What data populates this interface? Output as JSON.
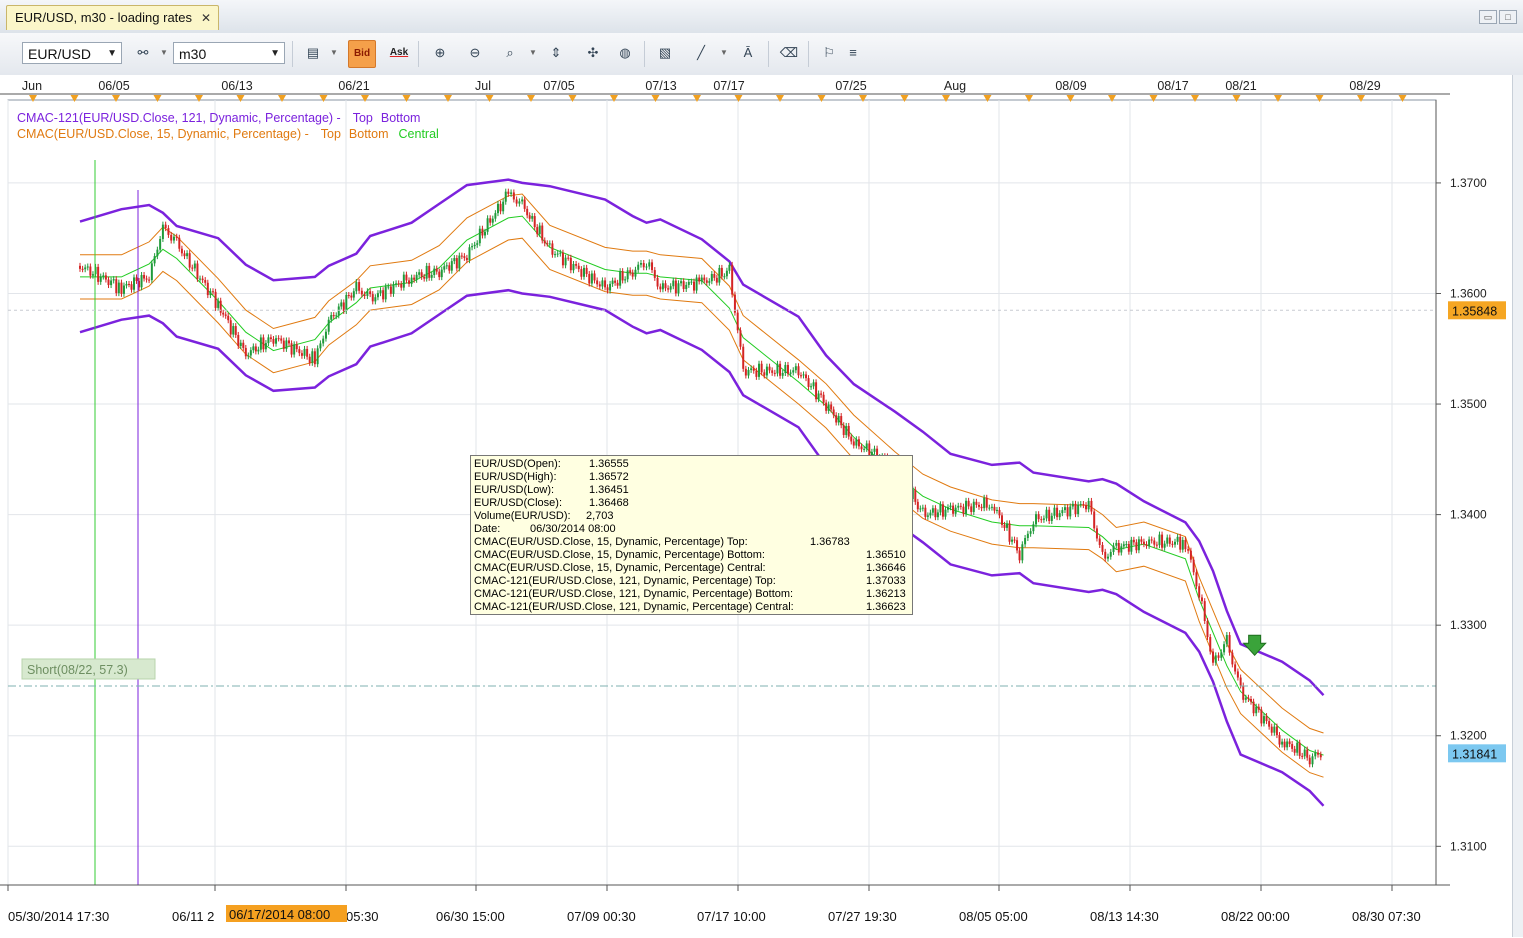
{
  "window": {
    "tab_title": "EUR/USD, m30 - loading rates",
    "close_glyph": "✕"
  },
  "toolbar": {
    "instrument": "EUR/USD",
    "timeframe": "m30",
    "bid_label": "Bid",
    "ask_label": "Ask"
  },
  "legend": {
    "line1_prefix": "CMAC-121(EUR/USD.Close, 121, Dynamic, Percentage) -",
    "line1_top": "Top",
    "line1_bottom": "Bottom",
    "line2_prefix": "CMAC(EUR/USD.Close, 15, Dynamic, Percentage) -",
    "line2_top": "Top",
    "line2_bottom": "Bottom",
    "line2_central": "Central"
  },
  "top_axis_labels": [
    "Jun",
    "06/05",
    "06/13",
    "06/21",
    "Jul",
    "07/05",
    "07/13",
    "07/17",
    "07/25",
    "Aug",
    "08/09",
    "08/17",
    "08/21",
    "08/29"
  ],
  "bottom_axis_labels": [
    "05/30/2014 17:30",
    "06/11 2",
    "05:30",
    "06/30 15:00",
    "07/09 00:30",
    "07/17 10:00",
    "07/27 19:30",
    "08/05 05:00",
    "08/13 14:30",
    "08/22 00:00",
    "08/30 07:30"
  ],
  "bottom_cursor_label": "06/17/2014 08:00",
  "price_labels": [
    "1.3700",
    "1.3600",
    "1.3500",
    "1.3400",
    "1.3300",
    "1.3200",
    "1.3100"
  ],
  "marker_price_1": "1.35848",
  "marker_price_2": "1.31841",
  "short_label": "Short(08/22, 57.3)",
  "tooltip": [
    {
      "label": "EUR/USD(Open):",
      "value": "1.36555"
    },
    {
      "label": "EUR/USD(High):",
      "value": "1.36572"
    },
    {
      "label": "EUR/USD(Low):",
      "value": "1.36451"
    },
    {
      "label": "EUR/USD(Close):",
      "value": "1.36468"
    },
    {
      "label": "Volume(EUR/USD):",
      "value": "2,703"
    },
    {
      "label": "Date:",
      "value": "06/30/2014 08:00"
    },
    {
      "label": "CMAC(EUR/USD.Close, 15, Dynamic, Percentage) Top:",
      "value": "1.36783"
    },
    {
      "label": "CMAC(EUR/USD.Close, 15, Dynamic, Percentage) Bottom:",
      "value": "1.36510"
    },
    {
      "label": "CMAC(EUR/USD.Close, 15, Dynamic, Percentage) Central:",
      "value": "1.36646"
    },
    {
      "label": "CMAC-121(EUR/USD.Close, 121, Dynamic, Percentage) Top:",
      "value": "1.37033"
    },
    {
      "label": "CMAC-121(EUR/USD.Close, 121, Dynamic, Percentage) Bottom:",
      "value": "1.36213"
    },
    {
      "label": "CMAC-121(EUR/USD.Close, 121, Dynamic, Percentage) Central:",
      "value": "1.36623"
    }
  ],
  "colors": {
    "cmac121": "#7b22dd",
    "cmac15": "#e07a10",
    "central": "#22cc22",
    "up": "#1f9a3a",
    "down": "#d42424",
    "short": "#8fc07a",
    "price_tag": "#f5a623",
    "price_tag2": "#7cc8f0"
  },
  "chart_data": {
    "type": "candlestick",
    "symbol": "EUR/USD",
    "timeframe": "m30",
    "ylim": [
      1.3065,
      1.3775
    ],
    "x_range": [
      "05/30/2014",
      "08/31/2014"
    ],
    "series_close_path": [
      [
        "05/30",
        1.3625
      ],
      [
        "06/02",
        1.3605
      ],
      [
        "06/04",
        1.3615
      ],
      [
        "06/05",
        1.366
      ],
      [
        "06/06",
        1.3645
      ],
      [
        "06/09",
        1.359
      ],
      [
        "06/11",
        1.3545
      ],
      [
        "06/13",
        1.356
      ],
      [
        "06/16",
        1.354
      ],
      [
        "06/17",
        1.3575
      ],
      [
        "06/19",
        1.3605
      ],
      [
        "06/20",
        1.3595
      ],
      [
        "06/23",
        1.3615
      ],
      [
        "06/25",
        1.362
      ],
      [
        "06/27",
        1.3635
      ],
      [
        "06/30",
        1.369
      ],
      [
        "07/01",
        1.368
      ],
      [
        "07/03",
        1.364
      ],
      [
        "07/07",
        1.3605
      ],
      [
        "07/09",
        1.362
      ],
      [
        "07/10",
        1.363
      ],
      [
        "07/11",
        1.3605
      ],
      [
        "07/14",
        1.361
      ],
      [
        "07/16",
        1.362
      ],
      [
        "07/17",
        1.353
      ],
      [
        "07/21",
        1.353
      ],
      [
        "07/23",
        1.35
      ],
      [
        "07/25",
        1.3465
      ],
      [
        "07/28",
        1.3445
      ],
      [
        "07/30",
        1.34
      ],
      [
        "08/01",
        1.3405
      ],
      [
        "08/04",
        1.341
      ],
      [
        "08/06",
        1.3365
      ],
      [
        "08/07",
        1.3395
      ],
      [
        "08/11",
        1.341
      ],
      [
        "08/12",
        1.336
      ],
      [
        "08/13",
        1.337
      ],
      [
        "08/15",
        1.3375
      ],
      [
        "08/18",
        1.3375
      ],
      [
        "08/19",
        1.333
      ],
      [
        "08/20",
        1.3265
      ],
      [
        "08/21",
        1.3285
      ],
      [
        "08/22",
        1.324
      ],
      [
        "08/25",
        1.3195
      ],
      [
        "08/27",
        1.318
      ],
      [
        "08/28",
        1.3185
      ]
    ],
    "annotations": [
      {
        "type": "horizontal",
        "value": 1.35848,
        "label": "1.35848"
      },
      {
        "type": "horizontal",
        "value": 1.3245,
        "label": "Short(08/22, 57.3)"
      },
      {
        "type": "signal",
        "date": "08/22",
        "direction": "short"
      }
    ]
  }
}
